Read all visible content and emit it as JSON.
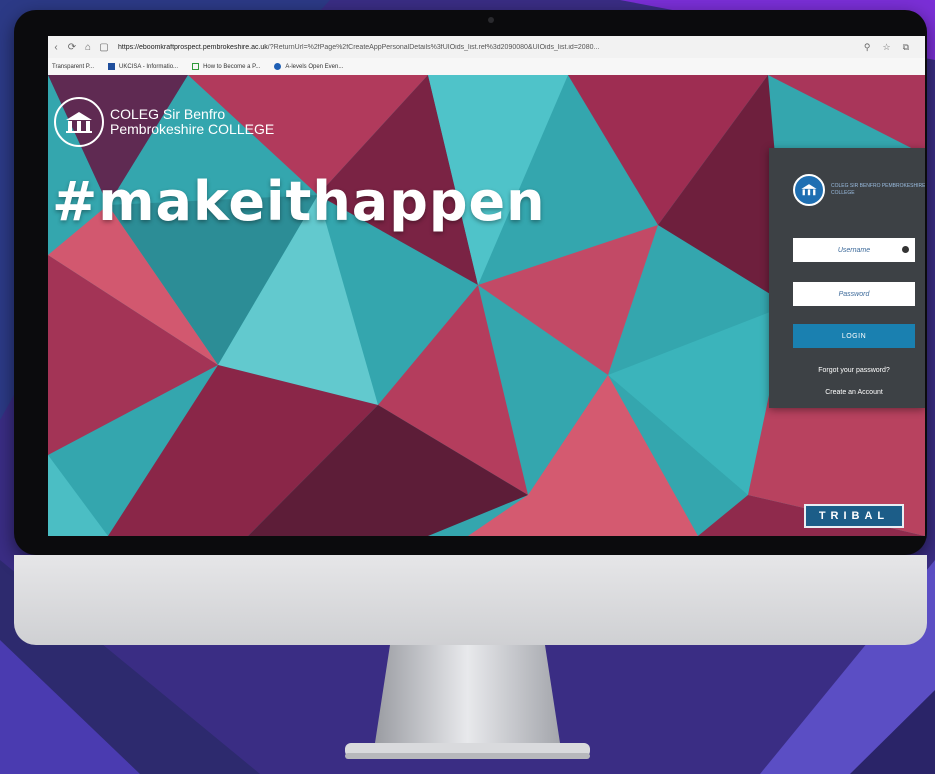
{
  "browser": {
    "url_host": "https://eboomkraftprospect.pembrokeshire.ac.uk",
    "url_rest": "/?ReturnUrl=%2fPage%2fCreateAppPersonalDetails%3fUIOids_list.ref%3d2090080&UIOids_list.id=2080...",
    "bookmarks": [
      "Transparent P...",
      "UKCISA - Informatio...",
      "How to Become a P...",
      "A-levels Open Even..."
    ]
  },
  "page": {
    "college_name_welsh": "COLEG Sir Benfro",
    "college_name_english": "Pembrokeshire COLLEGE",
    "hashtag": "#makeithappen"
  },
  "login": {
    "logo_text": "COLEG SIR BENFRO PEMBROKESHIRE COLLEGE",
    "username_placeholder": "Username",
    "password_placeholder": "Password",
    "login_label": "LOGIN",
    "forgot_link": "Forgot your password?",
    "create_link": "Create an Account"
  },
  "footer_brand": "TRIBAL",
  "colors": {
    "background": "#3b2f86",
    "panel": "#3d4145",
    "login_button": "#1a80b0",
    "teal": "#3fb8c0",
    "crimson": "#9c2b4d"
  }
}
